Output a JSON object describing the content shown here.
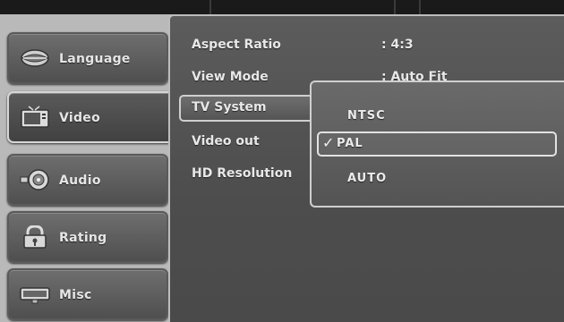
{
  "sidebar": {
    "items": [
      {
        "label": "Language",
        "icon": "lips-icon"
      },
      {
        "label": "Video",
        "icon": "tv-icon"
      },
      {
        "label": "Audio",
        "icon": "speaker-icon"
      },
      {
        "label": "Rating",
        "icon": "lock-icon"
      },
      {
        "label": "Misc",
        "icon": "monitor-icon"
      }
    ],
    "selected": "Video"
  },
  "settings": {
    "rows": [
      {
        "label": "Aspect Ratio",
        "value": ": 4:3"
      },
      {
        "label": "View Mode",
        "value": ": Auto Fit"
      },
      {
        "label": "TV System",
        "value": ""
      },
      {
        "label": "Video out",
        "value": ""
      },
      {
        "label": "HD Resolution",
        "value": ""
      }
    ]
  },
  "dropdown": {
    "options": [
      "NTSC",
      "PAL",
      "AUTO"
    ],
    "selected": "PAL",
    "check_glyph": "✓"
  },
  "colors": {
    "panel": "#4d4d4d",
    "sidebar_tab": "#5a5a5a",
    "highlight_border": "#cfcfcf",
    "text": "#e8e8e8"
  }
}
